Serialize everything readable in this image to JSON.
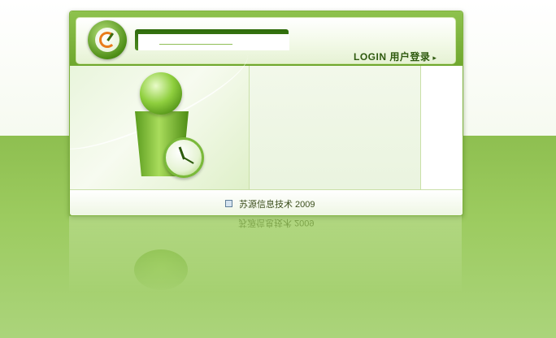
{
  "header": {
    "login_label": "LOGIN 用户登录",
    "login_arrow": "▸"
  },
  "footer": {
    "text": "苏源信息技术 2009",
    "icon": "document-icon"
  },
  "colors": {
    "brand_green": "#6fa72e",
    "dark_green": "#2f5a0f",
    "background_green": "#9ccb5f"
  }
}
